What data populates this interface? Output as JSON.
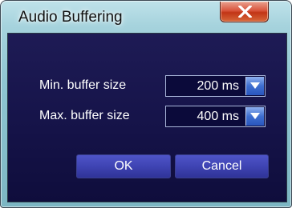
{
  "window": {
    "title": "Audio Buffering"
  },
  "settings": {
    "min_buffer": {
      "label": "Min. buffer size",
      "value": "200 ms"
    },
    "max_buffer": {
      "label": "Max. buffer size",
      "value": "400 ms"
    }
  },
  "buttons": {
    "ok_label": "OK",
    "cancel_label": "Cancel"
  },
  "icons": {
    "close": "close-icon",
    "dropdown": "chevron-down-icon"
  },
  "colors": {
    "title_bar": "#a6d3dd",
    "client_background": "#16144a",
    "button": "#3f44b3",
    "close_button": "#c23516",
    "dropdown_arrow": "#3e6ed0"
  }
}
